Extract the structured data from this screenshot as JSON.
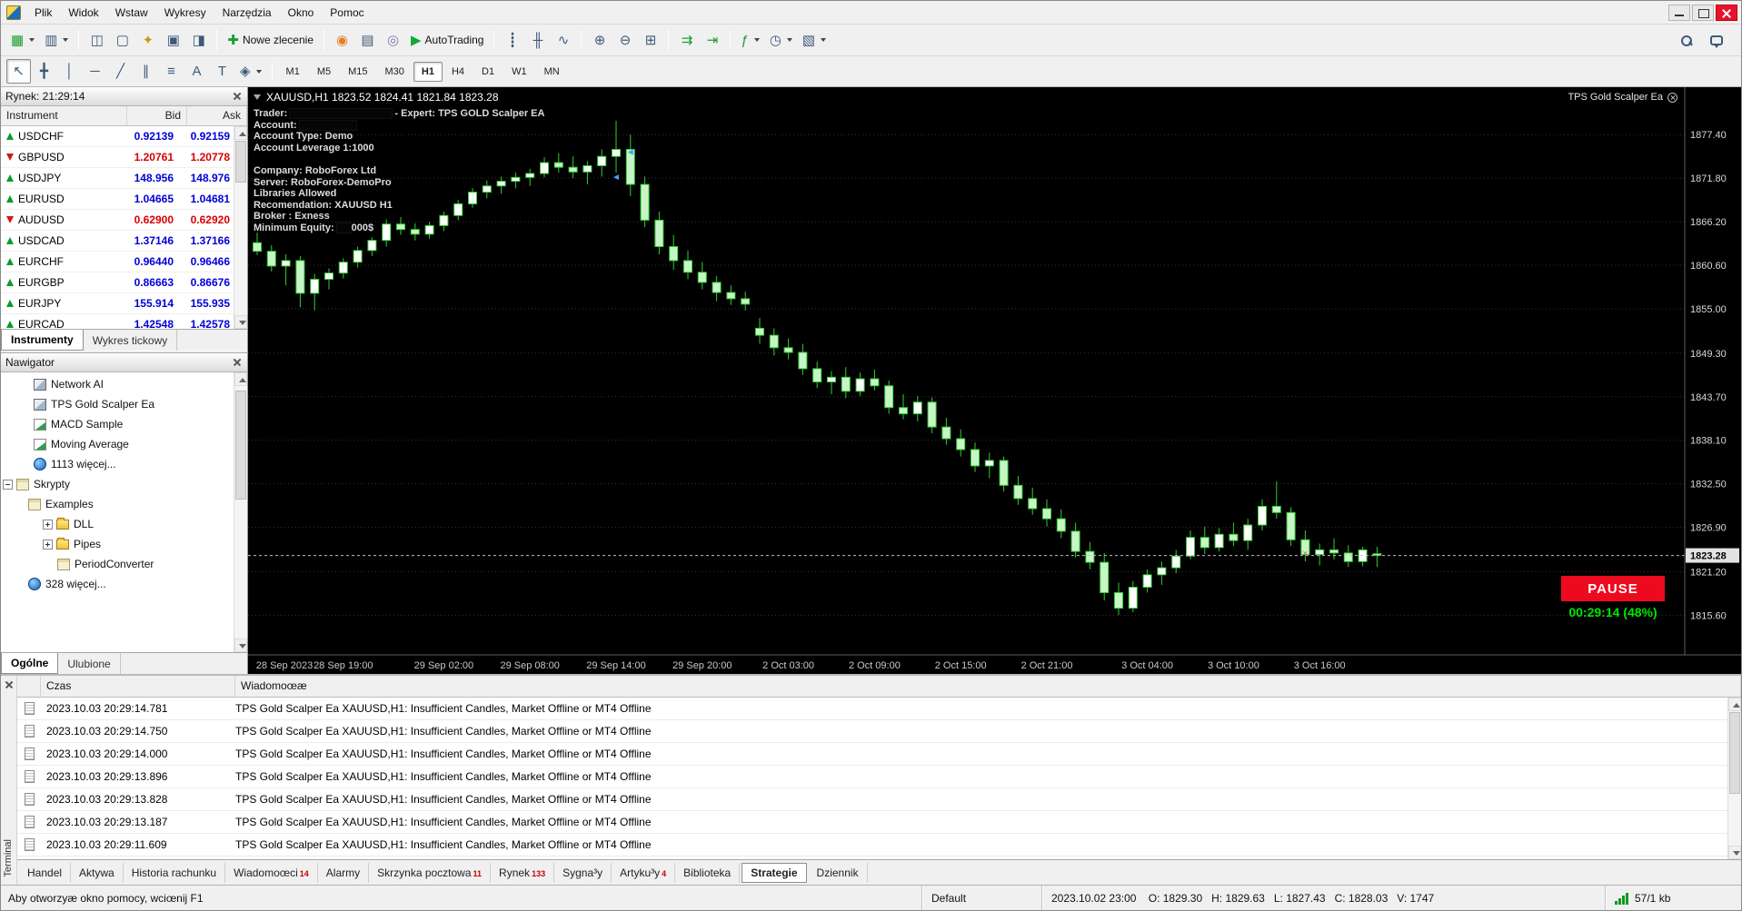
{
  "menubar": {
    "items": [
      "Plik",
      "Widok",
      "Wstaw",
      "Wykresy",
      "Narzędzia",
      "Okno",
      "Pomoc"
    ]
  },
  "window_controls": [
    {
      "name": "minimize"
    },
    {
      "name": "maximize"
    },
    {
      "name": "close"
    }
  ],
  "toolbar1": [
    {
      "name": "new-chart",
      "glyph": "▦",
      "accent": "#1a9c2e",
      "dropdown": true
    },
    {
      "name": "profiles",
      "glyph": "▥",
      "dropdown": true
    },
    {
      "sep": true
    },
    {
      "name": "market-watch-toggle",
      "glyph": "◫"
    },
    {
      "name": "data-window",
      "glyph": "▢"
    },
    {
      "name": "navigator-toggle",
      "glyph": "✦",
      "accent": "#c79a1a"
    },
    {
      "name": "terminal-toggle",
      "glyph": "▣"
    },
    {
      "name": "strategy-tester",
      "glyph": "◨"
    },
    {
      "sep": true
    },
    {
      "name": "new-order",
      "glyph": "✚",
      "label": "Nowe zlecenie",
      "accent": "#1a9c2e"
    },
    {
      "sep": true
    },
    {
      "name": "metaeditor",
      "glyph": "◉",
      "accent": "#e67e22"
    },
    {
      "name": "print",
      "glyph": "▤"
    },
    {
      "name": "publish-report",
      "glyph": "◎",
      "accent": "#7a7aa8"
    },
    {
      "name": "autotrading",
      "glyph": "▶",
      "label": "AutoTrading",
      "accent": "#0fa832"
    },
    {
      "sep": true
    },
    {
      "name": "chart-bars",
      "glyph": "┋"
    },
    {
      "name": "chart-candles",
      "glyph": "╫"
    },
    {
      "name": "chart-line",
      "glyph": "∿"
    },
    {
      "sep": true
    },
    {
      "name": "zoom-in",
      "glyph": "⊕"
    },
    {
      "name": "zoom-out",
      "glyph": "⊖"
    },
    {
      "name": "tile-windows",
      "glyph": "⊞"
    },
    {
      "sep": true
    },
    {
      "name": "auto-scroll",
      "glyph": "⇉",
      "accent": "#1a9c2e"
    },
    {
      "name": "chart-shift",
      "glyph": "⇥",
      "accent": "#1a9c2e"
    },
    {
      "sep": true
    },
    {
      "name": "indicators",
      "glyph": "ƒ",
      "accent": "#1a9c2e",
      "dropdown": true
    },
    {
      "name": "periods",
      "glyph": "◷",
      "dropdown": true
    },
    {
      "name": "templates",
      "glyph": "▧",
      "dropdown": true
    }
  ],
  "toolbar2": {
    "tools": [
      {
        "name": "cursor",
        "glyph": "↖",
        "active": true
      },
      {
        "name": "crosshair",
        "glyph": "╋"
      },
      {
        "name": "vertical-line",
        "glyph": "│"
      },
      {
        "name": "horizontal-line",
        "glyph": "─"
      },
      {
        "name": "trendline",
        "glyph": "╱"
      },
      {
        "name": "equidistant-channel",
        "glyph": "∥"
      },
      {
        "name": "fibonacci",
        "glyph": "≡"
      },
      {
        "name": "text",
        "glyph": "A"
      },
      {
        "name": "text-label",
        "glyph": "T"
      },
      {
        "name": "arrows-dropdown",
        "glyph": "◈",
        "dropdown": true
      }
    ],
    "timeframes": [
      "M1",
      "M5",
      "M15",
      "M30",
      "H1",
      "H4",
      "D1",
      "W1",
      "MN"
    ],
    "active_timeframe": "H1"
  },
  "market_watch": {
    "title": "Rynek: 21:29:14",
    "col_symbol": "Instrument",
    "col_bid": "Bid",
    "col_ask": "Ask",
    "rows": [
      {
        "symbol": "USDCHF",
        "bid": "0.92139",
        "ask": "0.92159",
        "dir": "up",
        "color": "#0000d8"
      },
      {
        "symbol": "GBPUSD",
        "bid": "1.20761",
        "ask": "1.20778",
        "dir": "down",
        "color": "#d80000"
      },
      {
        "symbol": "USDJPY",
        "bid": "148.956",
        "ask": "148.976",
        "dir": "up",
        "color": "#0000d8"
      },
      {
        "symbol": "EURUSD",
        "bid": "1.04665",
        "ask": "1.04681",
        "dir": "up",
        "color": "#0000d8"
      },
      {
        "symbol": "AUDUSD",
        "bid": "0.62900",
        "ask": "0.62920",
        "dir": "down",
        "color": "#d80000"
      },
      {
        "symbol": "USDCAD",
        "bid": "1.37146",
        "ask": "1.37166",
        "dir": "up",
        "color": "#0000d8"
      },
      {
        "symbol": "EURCHF",
        "bid": "0.96440",
        "ask": "0.96466",
        "dir": "up",
        "color": "#0000d8"
      },
      {
        "symbol": "EURGBP",
        "bid": "0.86663",
        "ask": "0.86676",
        "dir": "up",
        "color": "#0000d8"
      },
      {
        "symbol": "EURJPY",
        "bid": "155.914",
        "ask": "155.935",
        "dir": "up",
        "color": "#0000d8"
      },
      {
        "symbol": "EURCAD",
        "bid": "1.42548",
        "ask": "1.42578",
        "dir": "up",
        "color": "#0000d8"
      }
    ],
    "tabs": [
      {
        "label": "Instrumenty",
        "active": true
      },
      {
        "label": "Wykres tickowy",
        "active": false
      }
    ]
  },
  "navigator": {
    "title": "Nawigator",
    "items": [
      {
        "label": "Network AI",
        "pad": 36,
        "icon": "ea"
      },
      {
        "label": "TPS Gold Scalper Ea",
        "pad": 36,
        "icon": "ea"
      },
      {
        "label": "MACD Sample",
        "pad": 36,
        "icon": "ind"
      },
      {
        "label": "Moving Average",
        "pad": 36,
        "icon": "ind"
      },
      {
        "label": "1113 więcej...",
        "pad": 36,
        "icon": "globe"
      },
      {
        "label": "Skrypty",
        "pad": 2,
        "icon": "script",
        "exp": "minus"
      },
      {
        "label": "Examples",
        "pad": 30,
        "icon": "script"
      },
      {
        "label": "DLL",
        "pad": 46,
        "icon": "folder",
        "exp": "plus"
      },
      {
        "label": "Pipes",
        "pad": 46,
        "icon": "folder",
        "exp": "plus"
      },
      {
        "label": "PeriodConverter",
        "pad": 62,
        "icon": "script"
      },
      {
        "label": "328 więcej...",
        "pad": 30,
        "icon": "globe"
      }
    ],
    "tabs": [
      {
        "label": "Ogólne",
        "active": true
      },
      {
        "label": "Ulubione",
        "active": false
      }
    ]
  },
  "chart": {
    "title": "XAUUSD,H1  1823.52 1824.41 1821.84 1823.28",
    "expert_badge": "TPS Gold Scalper Ea",
    "pause_label": "PAUSE",
    "timer": "00:29:14 (48%)",
    "info_lines": [
      {
        "segs": [
          {
            "t": "Trader: "
          },
          {
            "redact": 112
          },
          {
            "t": "  -  Expert: TPS GOLD Scalper EA"
          }
        ]
      },
      {
        "segs": [
          {
            "t": "Account: "
          },
          {
            "redact": 62
          }
        ]
      },
      {
        "segs": [
          {
            "t": "Account Type: Demo"
          }
        ]
      },
      {
        "segs": [
          {
            "t": "Account Leverage 1:1000"
          }
        ]
      },
      {
        "segs": [
          {
            "t": " "
          }
        ]
      },
      {
        "segs": [
          {
            "t": "Company: RoboForex Ltd"
          }
        ]
      },
      {
        "segs": [
          {
            "t": "Server: RoboForex-DemoPro"
          }
        ]
      },
      {
        "segs": [
          {
            "t": "Libraries Allowed"
          }
        ]
      },
      {
        "segs": [
          {
            "t": "Recomendation: XAUUSD H1"
          }
        ]
      },
      {
        "segs": [
          {
            "t": "Broker : Exness"
          }
        ]
      },
      {
        "segs": [
          {
            "t": "Minimum Equity: "
          },
          {
            "redact": 16
          },
          {
            "t": "000$"
          }
        ]
      }
    ]
  },
  "chart_data": {
    "type": "candlestick",
    "symbol": "XAUUSD",
    "timeframe": "H1",
    "ohlc_display": {
      "open": "1823.52",
      "high": "1824.41",
      "low": "1821.84",
      "close": "1823.28"
    },
    "ylim": [
      1810.5,
      1883.5
    ],
    "y_ticks": [
      "1877.40",
      "1871.80",
      "1866.20",
      "1860.60",
      "1855.00",
      "1849.30",
      "1843.70",
      "1838.10",
      "1832.50",
      "1826.90",
      "1821.20",
      "1815.60"
    ],
    "current_price": 1823.28,
    "current_price_label": "1823.28",
    "x_labels": [
      {
        "i": 0,
        "t": "28 Sep 2023"
      },
      {
        "i": 6,
        "t": "28 Sep 19:00"
      },
      {
        "i": 13,
        "t": "29 Sep 02:00"
      },
      {
        "i": 19,
        "t": "29 Sep 08:00"
      },
      {
        "i": 25,
        "t": "29 Sep 14:00"
      },
      {
        "i": 31,
        "t": "29 Sep 20:00"
      },
      {
        "i": 37,
        "t": "2 Oct 03:00"
      },
      {
        "i": 43,
        "t": "2 Oct 09:00"
      },
      {
        "i": 49,
        "t": "2 Oct 15:00"
      },
      {
        "i": 55,
        "t": "2 Oct 21:00"
      },
      {
        "i": 62,
        "t": "3 Oct 04:00"
      },
      {
        "i": 68,
        "t": "3 Oct 10:00"
      },
      {
        "i": 74,
        "t": "3 Oct 16:00"
      }
    ],
    "layout": {
      "x0": 10,
      "step": 15.8,
      "body_w": 9,
      "axis_w": 62,
      "time_axis_h": 21
    },
    "colors": {
      "bg": "#000000",
      "grid": "#333333",
      "candle": "#32cd32",
      "bull_fill": "#ffffff",
      "bear_fill": "#c8f5c8",
      "axis_text": "#d8d8d8",
      "bid_line": "#c0c0c0"
    },
    "candles": [
      [
        1863.5,
        1864.8,
        1861.9,
        1862.4
      ],
      [
        1862.4,
        1863.2,
        1859.8,
        1860.5
      ],
      [
        1860.5,
        1862.0,
        1858.0,
        1861.2
      ],
      [
        1861.2,
        1861.8,
        1855.2,
        1857.0
      ],
      [
        1857.0,
        1859.5,
        1854.8,
        1858.8
      ],
      [
        1858.8,
        1860.2,
        1857.5,
        1859.6
      ],
      [
        1859.6,
        1861.5,
        1858.9,
        1861.0
      ],
      [
        1861.0,
        1863.0,
        1860.3,
        1862.5
      ],
      [
        1862.5,
        1864.2,
        1861.8,
        1863.8
      ],
      [
        1863.8,
        1866.5,
        1863.0,
        1865.9
      ],
      [
        1865.9,
        1866.8,
        1864.5,
        1865.2
      ],
      [
        1865.2,
        1866.0,
        1863.8,
        1864.6
      ],
      [
        1864.6,
        1866.2,
        1864.0,
        1865.7
      ],
      [
        1865.7,
        1867.5,
        1865.0,
        1867.0
      ],
      [
        1867.0,
        1869.0,
        1866.4,
        1868.5
      ],
      [
        1868.5,
        1870.5,
        1868.0,
        1870.0
      ],
      [
        1870.0,
        1871.5,
        1869.2,
        1870.8
      ],
      [
        1870.8,
        1872.0,
        1869.8,
        1871.4
      ],
      [
        1871.4,
        1872.5,
        1870.5,
        1871.9
      ],
      [
        1871.9,
        1873.0,
        1870.8,
        1872.4
      ],
      [
        1872.4,
        1874.5,
        1871.9,
        1873.8
      ],
      [
        1873.8,
        1875.0,
        1872.5,
        1873.2
      ],
      [
        1873.2,
        1874.6,
        1871.8,
        1872.6
      ],
      [
        1872.6,
        1874.0,
        1871.0,
        1873.4
      ],
      [
        1873.4,
        1875.5,
        1872.0,
        1874.6
      ],
      [
        1874.6,
        1879.2,
        1872.5,
        1875.5
      ],
      [
        1875.5,
        1877.4,
        1869.5,
        1871.0
      ],
      [
        1871.0,
        1872.0,
        1865.5,
        1866.4
      ],
      [
        1866.4,
        1867.5,
        1862.0,
        1863.0
      ],
      [
        1863.0,
        1864.5,
        1860.0,
        1861.2
      ],
      [
        1861.2,
        1862.5,
        1858.8,
        1859.7
      ],
      [
        1859.7,
        1861.0,
        1857.5,
        1858.4
      ],
      [
        1858.4,
        1859.2,
        1856.0,
        1857.1
      ],
      [
        1857.1,
        1858.0,
        1855.5,
        1856.3
      ],
      [
        1856.3,
        1857.2,
        1854.8,
        1855.6
      ],
      [
        1852.5,
        1853.8,
        1850.5,
        1851.6
      ],
      [
        1851.6,
        1852.5,
        1849.0,
        1850.0
      ],
      [
        1850.0,
        1851.2,
        1848.5,
        1849.4
      ],
      [
        1849.4,
        1850.5,
        1846.5,
        1847.3
      ],
      [
        1847.3,
        1848.2,
        1844.8,
        1845.6
      ],
      [
        1845.6,
        1847.0,
        1844.0,
        1846.2
      ],
      [
        1846.2,
        1847.5,
        1843.5,
        1844.4
      ],
      [
        1844.4,
        1846.8,
        1843.8,
        1846.0
      ],
      [
        1846.0,
        1847.2,
        1844.5,
        1845.1
      ],
      [
        1845.1,
        1845.8,
        1841.5,
        1842.3
      ],
      [
        1842.3,
        1844.0,
        1840.8,
        1841.5
      ],
      [
        1841.5,
        1843.8,
        1840.5,
        1843.0
      ],
      [
        1843.0,
        1843.6,
        1839.0,
        1839.8
      ],
      [
        1839.8,
        1841.0,
        1837.5,
        1838.3
      ],
      [
        1838.3,
        1839.5,
        1836.0,
        1836.9
      ],
      [
        1836.9,
        1837.8,
        1834.0,
        1834.8
      ],
      [
        1834.8,
        1836.5,
        1833.2,
        1835.5
      ],
      [
        1835.5,
        1836.0,
        1831.5,
        1832.3
      ],
      [
        1832.3,
        1833.5,
        1829.8,
        1830.6
      ],
      [
        1830.6,
        1832.0,
        1828.5,
        1829.3
      ],
      [
        1829.3,
        1830.5,
        1827.0,
        1828.0
      ],
      [
        1828.0,
        1829.2,
        1825.5,
        1826.4
      ],
      [
        1826.4,
        1827.5,
        1823.0,
        1823.8
      ],
      [
        1823.8,
        1825.0,
        1821.5,
        1822.4
      ],
      [
        1822.4,
        1823.6,
        1817.5,
        1818.5
      ],
      [
        1818.5,
        1819.8,
        1815.6,
        1816.5
      ],
      [
        1816.5,
        1820.0,
        1816.0,
        1819.2
      ],
      [
        1819.2,
        1821.5,
        1818.5,
        1820.8
      ],
      [
        1820.8,
        1822.5,
        1819.5,
        1821.7
      ],
      [
        1821.7,
        1824.0,
        1821.0,
        1823.2
      ],
      [
        1823.2,
        1826.5,
        1822.8,
        1825.6
      ],
      [
        1825.6,
        1827.0,
        1823.5,
        1824.3
      ],
      [
        1824.3,
        1826.8,
        1823.8,
        1826.0
      ],
      [
        1826.0,
        1827.5,
        1824.5,
        1825.2
      ],
      [
        1825.2,
        1828.0,
        1824.0,
        1827.2
      ],
      [
        1827.2,
        1830.5,
        1826.5,
        1829.6
      ],
      [
        1829.6,
        1832.8,
        1828.0,
        1828.8
      ],
      [
        1828.8,
        1829.5,
        1824.5,
        1825.3
      ],
      [
        1825.3,
        1826.5,
        1822.5,
        1823.4
      ],
      [
        1823.4,
        1824.8,
        1822.0,
        1824.0
      ],
      [
        1824.0,
        1825.5,
        1822.8,
        1823.6
      ],
      [
        1823.6,
        1824.6,
        1821.8,
        1822.5
      ],
      [
        1822.5,
        1824.4,
        1821.9,
        1824.0
      ],
      [
        1823.5,
        1824.4,
        1821.8,
        1823.3
      ]
    ],
    "markers": [
      {
        "i": 26,
        "p": 1874.8,
        "glyph": "◄",
        "color": "#4a9aff"
      },
      {
        "i": 25,
        "p": 1871.6,
        "glyph": "◄",
        "color": "#4a9aff"
      },
      {
        "i": 73,
        "p": 1823.2,
        "glyph": "×",
        "color": "#ff4040"
      }
    ]
  },
  "terminal": {
    "side_label": "Terminal",
    "col_time": "Czas",
    "col_msg": "Wiadomoœæ",
    "rows": [
      {
        "time": "2023.10.03 20:29:14.781",
        "message": "TPS Gold Scalper Ea XAUUSD,H1: Insufficient Candles, Market Offline or MT4 Offline"
      },
      {
        "time": "2023.10.03 20:29:14.750",
        "message": "TPS Gold Scalper Ea XAUUSD,H1: Insufficient Candles, Market Offline or MT4 Offline"
      },
      {
        "time": "2023.10.03 20:29:14.000",
        "message": "TPS Gold Scalper Ea XAUUSD,H1: Insufficient Candles, Market Offline or MT4 Offline"
      },
      {
        "time": "2023.10.03 20:29:13.896",
        "message": "TPS Gold Scalper Ea XAUUSD,H1: Insufficient Candles, Market Offline or MT4 Offline"
      },
      {
        "time": "2023.10.03 20:29:13.828",
        "message": "TPS Gold Scalper Ea XAUUSD,H1: Insufficient Candles, Market Offline or MT4 Offline"
      },
      {
        "time": "2023.10.03 20:29:13.187",
        "message": "TPS Gold Scalper Ea XAUUSD,H1: Insufficient Candles, Market Offline or MT4 Offline"
      },
      {
        "time": "2023.10.03 20:29:11.609",
        "message": "TPS Gold Scalper Ea XAUUSD,H1: Insufficient Candles, Market Offline or MT4 Offline"
      }
    ],
    "tabs": [
      {
        "label": "Handel"
      },
      {
        "label": "Aktywa"
      },
      {
        "label": "Historia rachunku"
      },
      {
        "label": "Wiadomoœci",
        "count": "14"
      },
      {
        "label": "Alarmy"
      },
      {
        "label": "Skrzynka pocztowa",
        "count": "11"
      },
      {
        "label": "Rynek",
        "count": "133"
      },
      {
        "label": "Sygna³y"
      },
      {
        "label": "Artyku³y",
        "count": "4"
      },
      {
        "label": "Biblioteka"
      },
      {
        "label": "Strategie",
        "active": true
      },
      {
        "label": "Dziennik"
      }
    ]
  },
  "status": {
    "help": "Aby otworzyæ okno pomocy, wciœnij F1",
    "profile": "Default",
    "quote": "2023.10.02 23:00    O: 1829.30   H: 1829.63   L: 1827.43   C: 1828.03   V: 1747",
    "net": "57/1 kb"
  }
}
